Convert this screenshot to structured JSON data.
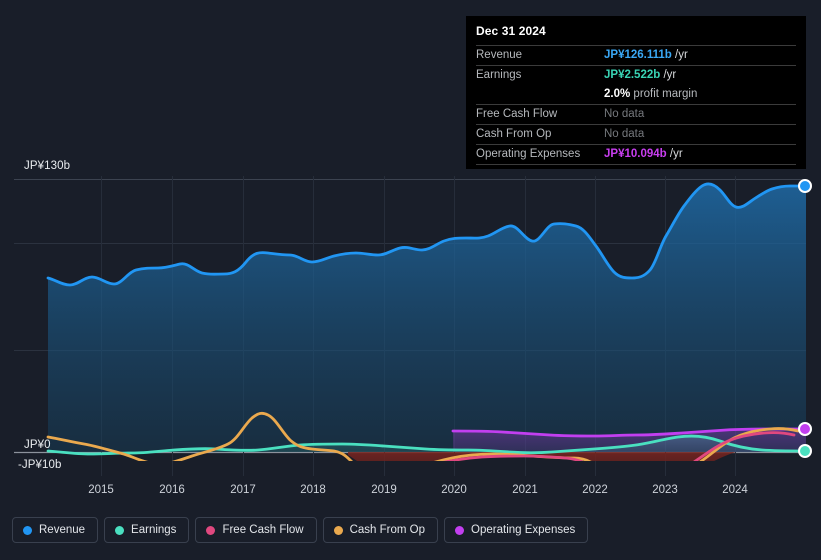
{
  "tooltip": {
    "date": "Dec 31 2024",
    "rows": [
      {
        "key": "Revenue",
        "amount": "JP¥126.111b",
        "unit": "/yr",
        "color_class": "amt-revenue",
        "no_data": false
      },
      {
        "key": "Earnings",
        "amount": "JP¥2.522b",
        "unit": "/yr",
        "color_class": "amt-earnings",
        "no_data": false
      },
      {
        "key": "",
        "amount": "2.0%",
        "unit": "profit margin",
        "color_class": "amt-margin",
        "no_data": false
      },
      {
        "key": "Free Cash Flow",
        "amount": "No data",
        "unit": "",
        "color_class": "",
        "no_data": true
      },
      {
        "key": "Cash From Op",
        "amount": "No data",
        "unit": "",
        "color_class": "",
        "no_data": true
      },
      {
        "key": "Operating Expenses",
        "amount": "JP¥10.094b",
        "unit": "/yr",
        "color_class": "amt-opex",
        "no_data": false
      }
    ]
  },
  "axis": {
    "y_top_label": "JP¥130b",
    "y_zero_label": "JP¥0",
    "y_neg_label": "-JP¥10b",
    "x_labels": [
      "2015",
      "2016",
      "2017",
      "2018",
      "2019",
      "2020",
      "2021",
      "2022",
      "2023",
      "2024"
    ]
  },
  "legend": {
    "items": [
      {
        "label": "Revenue",
        "color": "#2196f3"
      },
      {
        "label": "Earnings",
        "color": "#4ae0c0"
      },
      {
        "label": "Free Cash Flow",
        "color": "#e0487f"
      },
      {
        "label": "Cash From Op",
        "color": "#eaa94e"
      },
      {
        "label": "Operating Expenses",
        "color": "#c23ff0"
      }
    ]
  },
  "chart_data": {
    "type": "area",
    "title": "",
    "xlabel": "",
    "ylabel": "JP¥",
    "ylim": [
      -10,
      130
    ],
    "grid": true,
    "legend_position": "bottom",
    "x_axis_years": [
      "2015",
      "2016",
      "2017",
      "2018",
      "2019",
      "2020",
      "2021",
      "2022",
      "2023",
      "2024"
    ],
    "y_ticks": [
      130,
      0,
      -10
    ],
    "currency": "JP¥",
    "units": "billions",
    "series": [
      {
        "name": "Revenue",
        "color": "#2196f3",
        "x": [
          2014.3,
          2014.6,
          2014.9,
          2015.2,
          2015.5,
          2015.8,
          2016.1,
          2016.4,
          2016.7,
          2017.0,
          2017.3,
          2017.6,
          2017.9,
          2018.2,
          2018.5,
          2018.8,
          2019.1,
          2019.4,
          2019.7,
          2020.0,
          2020.3,
          2020.6,
          2020.9,
          2021.2,
          2021.5,
          2021.8,
          2022.1,
          2022.4,
          2022.7,
          2023.0,
          2023.3,
          2023.6,
          2023.9,
          2024.2,
          2024.5,
          2024.8,
          2025.0
        ],
        "values": [
          73.5,
          70.0,
          72.5,
          69.5,
          69.5,
          75.0,
          76.0,
          76.5,
          74.0,
          73.5,
          79.5,
          78.5,
          79.0,
          79.5,
          79.0,
          81.5,
          83.5,
          82.0,
          84.0,
          88.0,
          87.5,
          90.5,
          92.5,
          100.0,
          100.5,
          99.5,
          92.0,
          80.5,
          80.0,
          88.0,
          105.0,
          118.0,
          122.5,
          114.5,
          118.5,
          124.0,
          126.111
        ]
      },
      {
        "name": "Earnings",
        "color": "#4ae0c0",
        "x": [
          2014.3,
          2014.9,
          2015.5,
          2016.1,
          2016.7,
          2017.3,
          2017.9,
          2018.5,
          2019.1,
          2019.7,
          2020.3,
          2020.9,
          2021.5,
          2022.1,
          2022.7,
          2023.3,
          2023.9,
          2024.5,
          2025.0
        ],
        "values": [
          0.4,
          -0.3,
          -0.2,
          0.2,
          0.5,
          1.1,
          0.9,
          1.3,
          1.4,
          1.3,
          0.9,
          0.6,
          0.3,
          0.4,
          0.6,
          1.5,
          2.6,
          2.4,
          2.522
        ]
      },
      {
        "name": "Free Cash Flow",
        "color": "#e0487f",
        "x": [
          2018.8,
          2019.2,
          2019.7,
          2020.3,
          2020.9,
          2021.5,
          2022.1,
          2022.7,
          2023.3,
          2023.9,
          2024.4
        ],
        "values": [
          -7.0,
          -4.4,
          -2.7,
          -2.3,
          -1.6,
          -1.9,
          -5.8,
          -6.6,
          -3.0,
          -0.6,
          -0.6
        ]
      },
      {
        "name": "Cash From Op",
        "color": "#eaa94e",
        "x": [
          2014.3,
          2014.9,
          2015.5,
          2016.1,
          2016.7,
          2017.3,
          2017.9,
          2018.3,
          2018.8,
          2019.4,
          2020.0,
          2020.6,
          2021.2,
          2021.8,
          2022.3,
          2022.9,
          2023.4,
          2023.9,
          2024.4
        ],
        "values": [
          1.5,
          0.3,
          -1.2,
          0.6,
          7.0,
          2.0,
          1.7,
          -2.2,
          -6.3,
          -4.3,
          -1.0,
          -0.3,
          -0.5,
          -1.0,
          -5.8,
          -6.2,
          -3.6,
          1.6,
          2.3
        ]
      },
      {
        "name": "Operating Expenses",
        "color": "#c23ff0",
        "x": [
          2019.9,
          2020.5,
          2021.1,
          2021.7,
          2022.3,
          2022.9,
          2023.5,
          2024.1,
          2025.0
        ],
        "values": [
          9.3,
          9.1,
          8.6,
          8.3,
          8.3,
          8.4,
          9.0,
          9.8,
          10.094
        ]
      }
    ]
  }
}
